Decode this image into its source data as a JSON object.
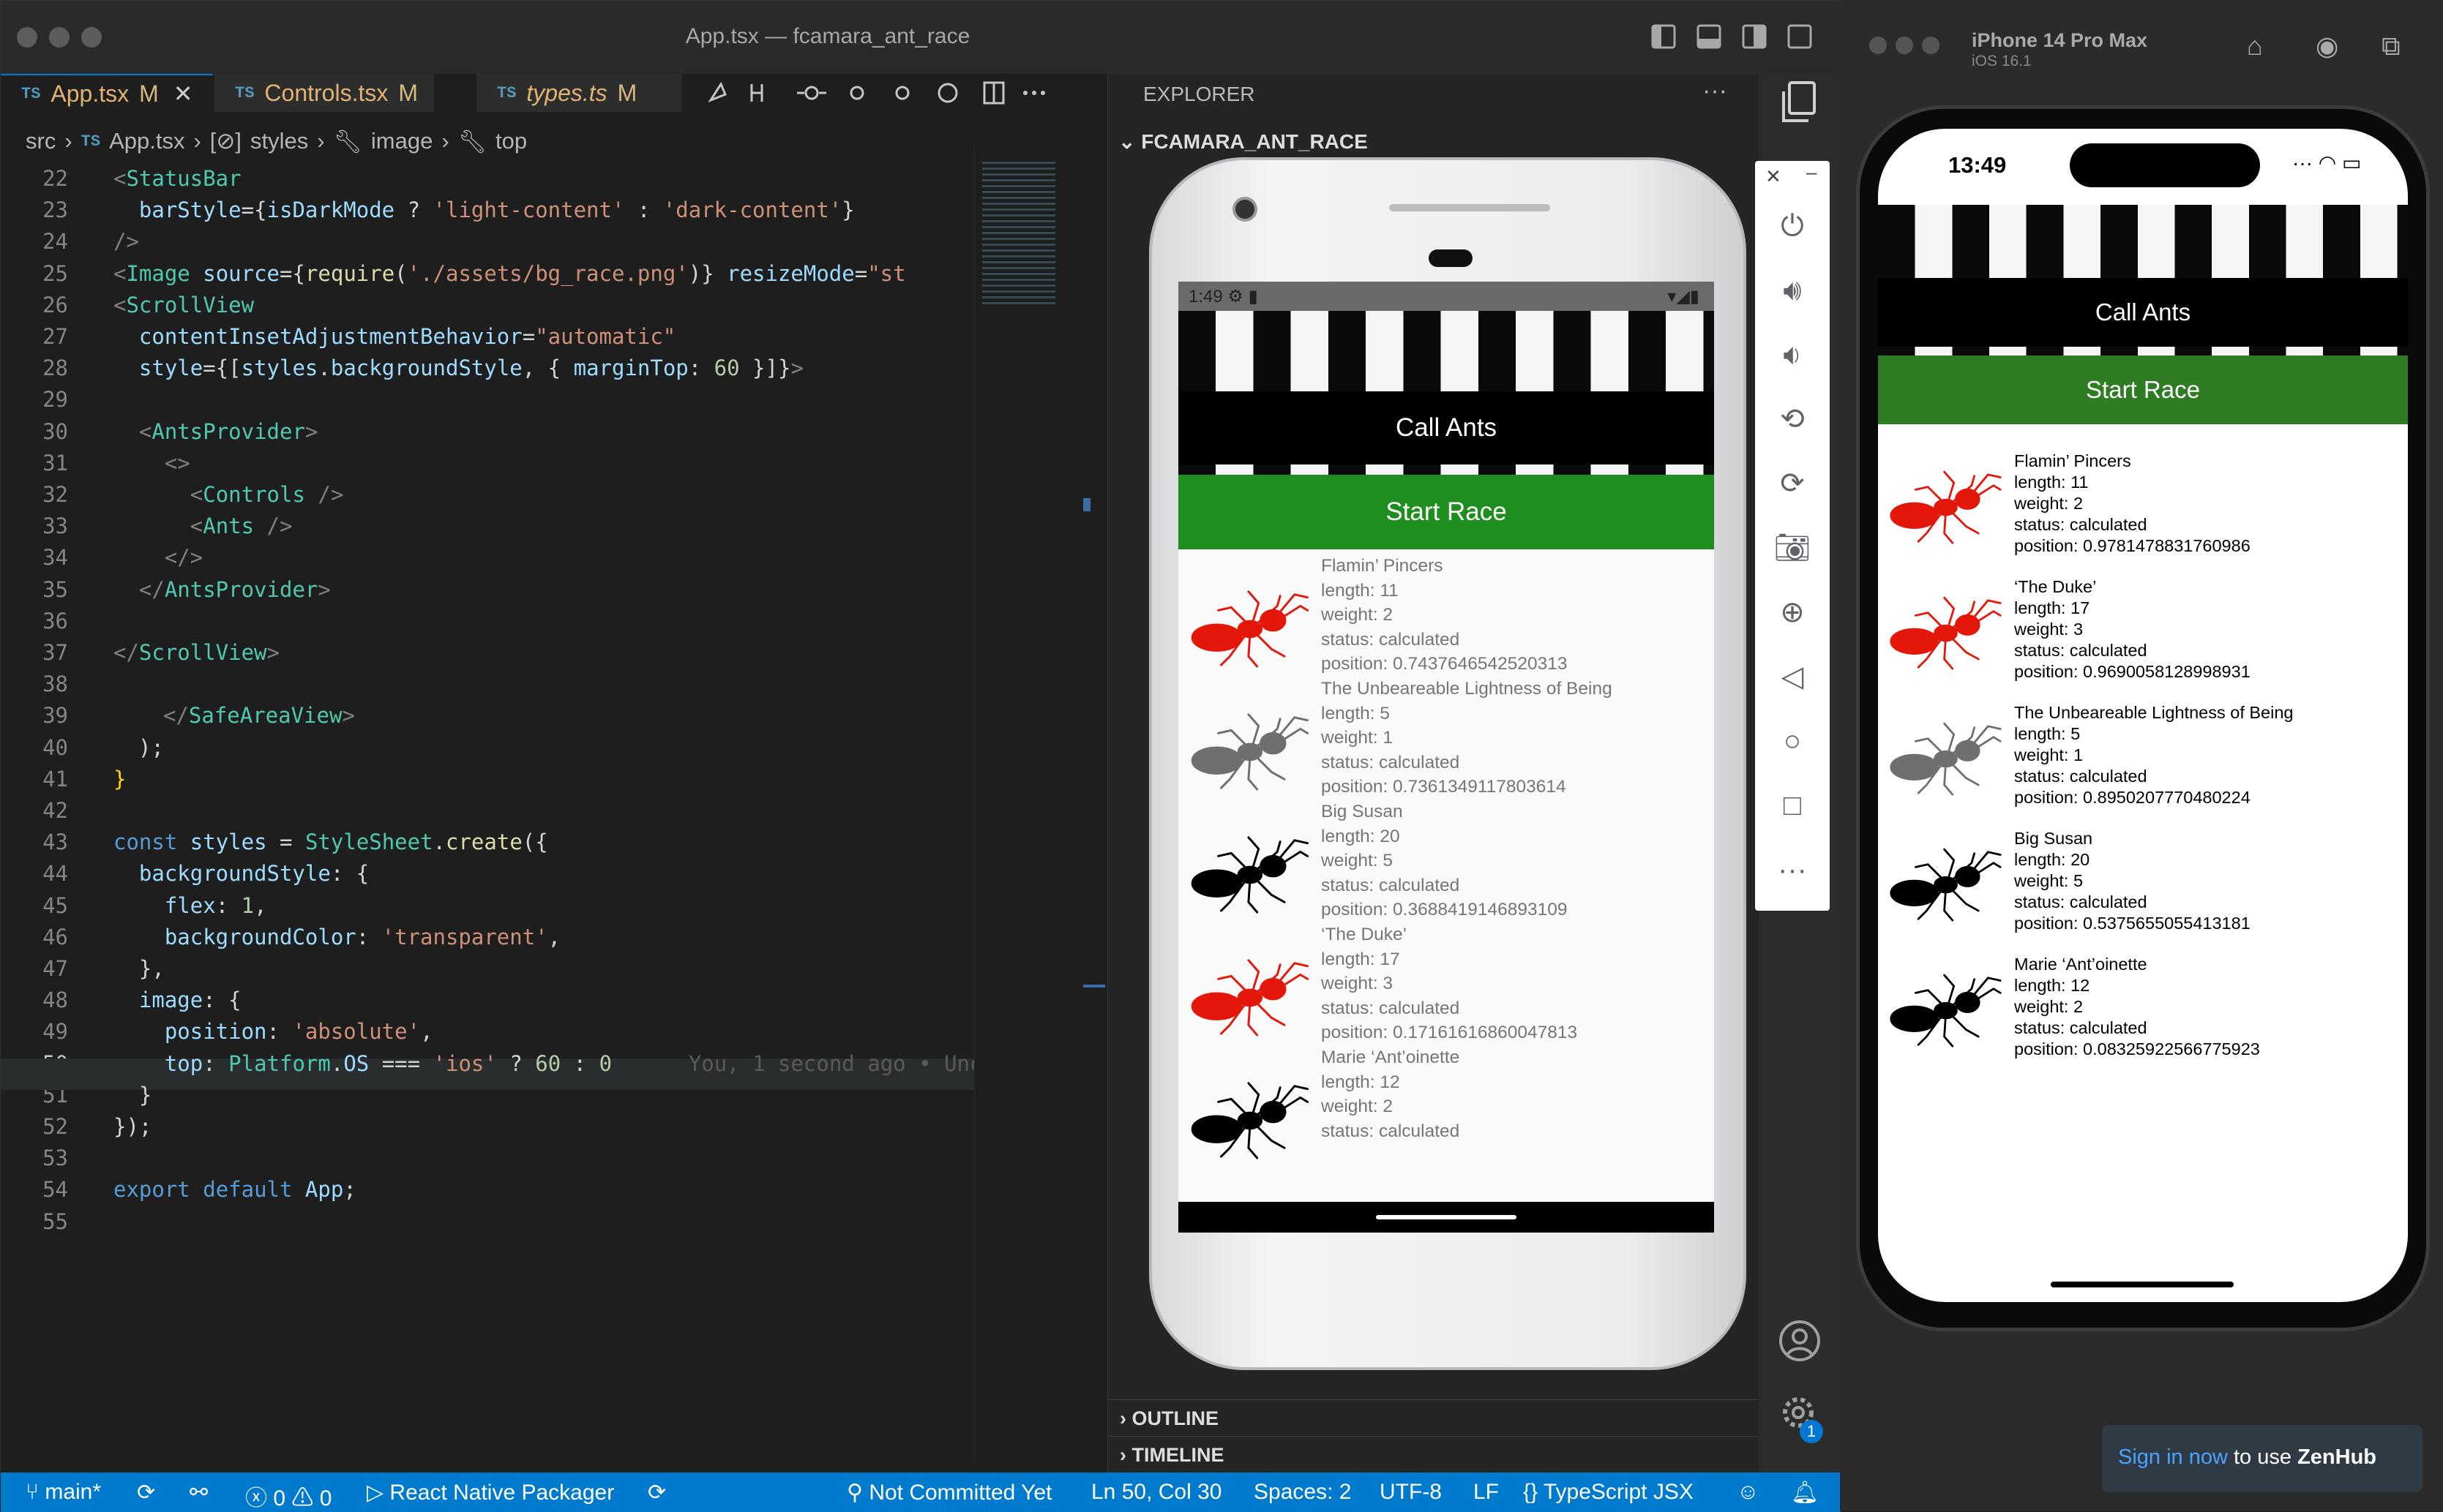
{
  "window": {
    "title": "App.tsx — fcamara_ant_race"
  },
  "tabs": [
    {
      "lang": "TS",
      "name": "App.tsx",
      "modified": "M"
    },
    {
      "lang": "TS",
      "name": "Controls.tsx",
      "modified": "M"
    },
    {
      "lang": "TS",
      "name": "types.ts",
      "modified": "M"
    }
  ],
  "breadcrumb": {
    "folder": "src",
    "lang": "TS",
    "file": "App.tsx",
    "symbol": "styles",
    "prop": "image",
    "leaf": "top"
  },
  "code": {
    "line_numbers": [
      "22",
      "23",
      "24",
      "25",
      "26",
      "27",
      "28",
      "29",
      "30",
      "31",
      "32",
      "33",
      "34",
      "35",
      "36",
      "37",
      "38",
      "39",
      "40",
      "41",
      "42",
      "43",
      "44",
      "45",
      "46",
      "47",
      "48",
      "49",
      "50",
      "51",
      "52",
      "53",
      "54",
      "55"
    ],
    "blame": "You, 1 second ago • Unc"
  },
  "explorer": {
    "header": "EXPLORER",
    "project": "FCAMARA_ANT_RACE",
    "outline": "OUTLINE",
    "timeline": "TIMELINE"
  },
  "status": {
    "branch": "main*",
    "errors": "0",
    "warnings": "0",
    "packager": "React Native Packager",
    "git": "Not Committed Yet",
    "cursor": "Ln 50, Col 30",
    "spaces": "Spaces: 2",
    "encoding": "UTF-8",
    "eol": "LF",
    "language": "TypeScript JSX",
    "badge": "1"
  },
  "android": {
    "time": "1:49",
    "call_button": "Call Ants",
    "start_button": "Start Race",
    "colors": {
      "green": "#1e8e1e",
      "red": "#e3170a",
      "gray": "#6f6f6f",
      "black": "#000000"
    },
    "ants": [
      {
        "name": "Flamin’ Pincers",
        "length": "length: 11",
        "weight": "weight: 2",
        "status": "status: calculated",
        "position": "position: 0.7437646542520313",
        "color": "#e3170a"
      },
      {
        "name": "The Unbeareable Lightness of Being",
        "length": "length: 5",
        "weight": "weight: 1",
        "status": "status: calculated",
        "position": "position: 0.7361349117803614",
        "color": "#6f6f6f"
      },
      {
        "name": "Big Susan",
        "length": "length: 20",
        "weight": "weight: 5",
        "status": "status: calculated",
        "position": "position: 0.3688419146893109",
        "color": "#000000"
      },
      {
        "name": "‘The Duke’",
        "length": "length: 17",
        "weight": "weight: 3",
        "status": "status: calculated",
        "position": "position: 0.17161616860047813",
        "color": "#e3170a"
      },
      {
        "name": "Marie ‘Ant’oinette",
        "length": "length: 12",
        "weight": "weight: 2",
        "status": "status: calculated",
        "position": "",
        "color": "#000000"
      }
    ]
  },
  "ios": {
    "device": "iPhone 14 Pro Max",
    "os": "iOS 16.1",
    "time": "13:49",
    "call_button": "Call Ants",
    "start_button": "Start Race",
    "ants": [
      {
        "name": "Flamin’ Pincers",
        "length": "length: 11",
        "weight": "weight: 2",
        "status": "status: calculated",
        "position": "position: 0.9781478831760986",
        "color": "#e3170a"
      },
      {
        "name": "‘The Duke’",
        "length": "length: 17",
        "weight": "weight: 3",
        "status": "status: calculated",
        "position": "position: 0.9690058128998931",
        "color": "#e3170a"
      },
      {
        "name": "The Unbeareable Lightness of Being",
        "length": "length: 5",
        "weight": "weight: 1",
        "status": "status: calculated",
        "position": "position: 0.8950207770480224",
        "color": "#6f6f6f"
      },
      {
        "name": "Big Susan",
        "length": "length: 20",
        "weight": "weight: 5",
        "status": "status: calculated",
        "position": "position: 0.5375655055413181",
        "color": "#000000"
      },
      {
        "name": "Marie ‘Ant’oinette",
        "length": "length: 12",
        "weight": "weight: 2",
        "status": "status: calculated",
        "position": "position: 0.08325922566775923",
        "color": "#000000"
      }
    ]
  },
  "zenhub": {
    "link": "Sign in now",
    "text": "to use",
    "brand": "ZenHub"
  }
}
